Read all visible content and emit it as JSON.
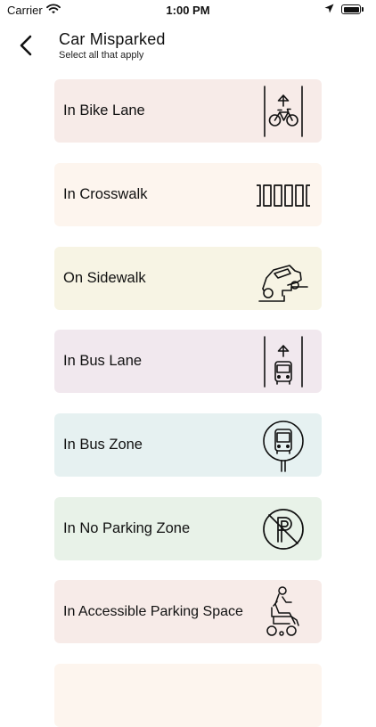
{
  "status": {
    "carrier": "Carrier",
    "time": "1:00 PM"
  },
  "header": {
    "title": "Car Misparked",
    "subtitle": "Select all that apply"
  },
  "options": [
    {
      "label": "In Bike Lane",
      "color": "#f7ebe8",
      "icon": "bike-lane-icon"
    },
    {
      "label": "In Crosswalk",
      "color": "#fdf5ee",
      "icon": "crosswalk-icon"
    },
    {
      "label": "On Sidewalk",
      "color": "#f7f4e4",
      "icon": "sidewalk-car-icon"
    },
    {
      "label": "In Bus Lane",
      "color": "#f1e8ee",
      "icon": "bus-lane-icon"
    },
    {
      "label": "In Bus Zone",
      "color": "#e6f1f1",
      "icon": "bus-stop-sign-icon"
    },
    {
      "label": "In No Parking Zone",
      "color": "#e8f2e8",
      "icon": "no-parking-icon"
    },
    {
      "label": "In Accessible Parking Space",
      "color": "#f7ebe8",
      "icon": "accessible-parking-icon"
    },
    {
      "label": "",
      "color": "#fdf5ee",
      "icon": ""
    }
  ]
}
